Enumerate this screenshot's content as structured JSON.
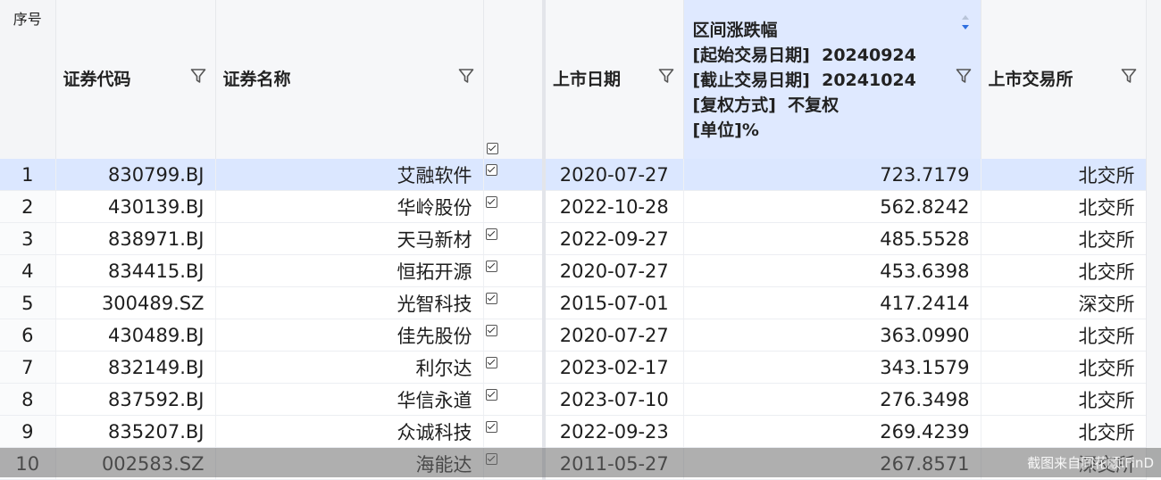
{
  "header": {
    "index": "序号",
    "code": "证券代码",
    "name": "证券名称",
    "list_date": "上市日期",
    "change": "区间涨跌幅\n[起始交易日期]  20240924\n[截止交易日期]  20241024\n[复权方式]  不复权\n[单位]%",
    "exchange": "上市交易所"
  },
  "rows": [
    {
      "index": "1",
      "code": "830799.BJ",
      "name": "艾融软件",
      "date": "2020-07-27",
      "change": "723.7179",
      "exchange": "北交所"
    },
    {
      "index": "2",
      "code": "430139.BJ",
      "name": "华岭股份",
      "date": "2022-10-28",
      "change": "562.8242",
      "exchange": "北交所"
    },
    {
      "index": "3",
      "code": "838971.BJ",
      "name": "天马新材",
      "date": "2022-09-27",
      "change": "485.5528",
      "exchange": "北交所"
    },
    {
      "index": "4",
      "code": "834415.BJ",
      "name": "恒拓开源",
      "date": "2020-07-27",
      "change": "453.6398",
      "exchange": "北交所"
    },
    {
      "index": "5",
      "code": "300489.SZ",
      "name": "光智科技",
      "date": "2015-07-01",
      "change": "417.2414",
      "exchange": "深交所"
    },
    {
      "index": "6",
      "code": "430489.BJ",
      "name": "佳先股份",
      "date": "2020-07-27",
      "change": "363.0990",
      "exchange": "北交所"
    },
    {
      "index": "7",
      "code": "832149.BJ",
      "name": "利尔达",
      "date": "2023-02-17",
      "change": "343.1579",
      "exchange": "北交所"
    },
    {
      "index": "8",
      "code": "837592.BJ",
      "name": "华信永道",
      "date": "2023-07-10",
      "change": "276.3498",
      "exchange": "北交所"
    },
    {
      "index": "9",
      "code": "835207.BJ",
      "name": "众诚科技",
      "date": "2022-09-23",
      "change": "269.4239",
      "exchange": "北交所"
    },
    {
      "index": "10",
      "code": "002583.SZ",
      "name": "海能达",
      "date": "2011-05-27",
      "change": "267.8571",
      "exchange": "深交所"
    }
  ],
  "watermark": "截图来自同花顺iFinD",
  "colors": {
    "selected_row": "#dbe7ff",
    "sorted_header": "#dfe9ff",
    "sort_arrow": "#2f6fe0"
  },
  "icons": {
    "filter": "filter-icon",
    "sort": "sort-desc-icon",
    "checkbox": "checkbox-checked-icon"
  }
}
